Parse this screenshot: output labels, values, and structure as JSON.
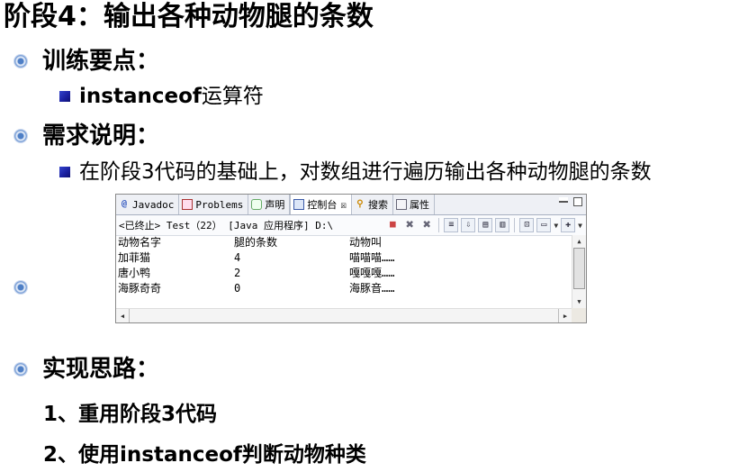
{
  "slide": {
    "title": "阶段4：输出各种动物腿的条数",
    "sections": [
      {
        "heading": "训练要点：",
        "item": {
          "bold": "instanceof",
          "text": "运算符"
        }
      },
      {
        "heading": "需求说明：",
        "item": {
          "bold": "",
          "text": "在阶段3代码的基础上，对数组进行遍历输出各种动物腿的条数"
        }
      },
      {
        "heading": "实现思路："
      }
    ],
    "steps": [
      "1、重用阶段3代码",
      "2、使用instanceof判断动物种类"
    ]
  },
  "console": {
    "tabs": [
      {
        "label": "Javadoc",
        "icon": "at-icon"
      },
      {
        "label": "Problems",
        "icon": "problems-icon"
      },
      {
        "label": "声明",
        "icon": "declaration-icon"
      },
      {
        "label": "控制台",
        "icon": "console-icon",
        "active": true,
        "close": "☒"
      },
      {
        "label": "搜索",
        "icon": "search-icon"
      },
      {
        "label": "属性",
        "icon": "properties-icon"
      }
    ],
    "status": "<已终止> Test（22） [Java 应用程序] D:\\",
    "headers": [
      "动物名字",
      "腿的条数",
      "动物叫"
    ],
    "rows": [
      [
        "加菲猫",
        "4",
        "喵喵喵……"
      ],
      [
        "唐小鸭",
        "2",
        "嘎嘎嘎……"
      ],
      [
        "海豚奇奇",
        "0",
        "海豚音……"
      ]
    ]
  }
}
